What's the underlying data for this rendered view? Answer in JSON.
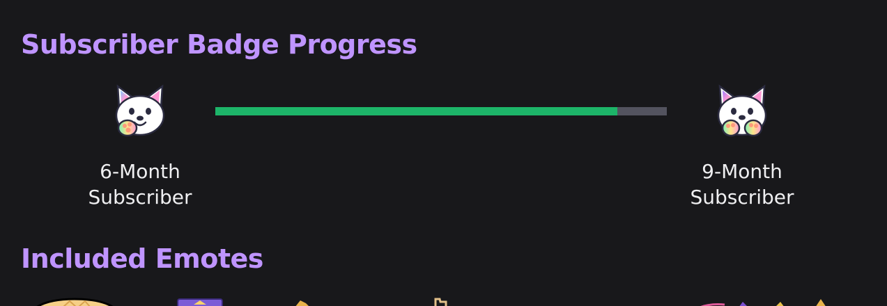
{
  "badge_section": {
    "title": "Subscriber Badge Progress",
    "current_badge": {
      "line1": "6-Month",
      "line2": "Subscriber",
      "icon": "bulldog-badge-icon"
    },
    "next_badge": {
      "line1": "9-Month",
      "line2": "Subscriber",
      "icon": "bulldog-badge-icon"
    },
    "progress_fraction": 0.89,
    "colors": {
      "fill": "#1db469",
      "track": "#53535f",
      "heading": "#bf94ff"
    }
  },
  "emotes_section": {
    "title": "Included Emotes",
    "emotes": [
      "blonde-emote-icon",
      "purple-emote-icon",
      "gold-emote-icon",
      "tan-emote-icon",
      "pink-emote-icon",
      "gold-emote-icon"
    ]
  }
}
